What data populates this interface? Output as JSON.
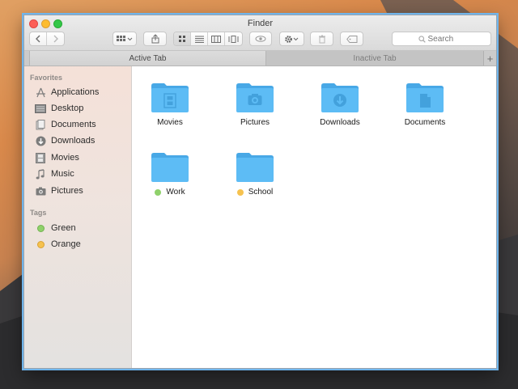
{
  "window": {
    "title": "Finder"
  },
  "toolbar": {
    "search_placeholder": "Search",
    "icons": [
      "back-arrow-icon",
      "forward-arrow-icon",
      "arrange-icon",
      "share-icon",
      "icon-view-icon",
      "list-view-icon",
      "column-view-icon",
      "coverflow-view-icon",
      "quicklook-eye-icon",
      "action-gear-icon",
      "trash-icon",
      "tag-icon"
    ]
  },
  "tabs": [
    {
      "label": "Active Tab",
      "active": true
    },
    {
      "label": "Inactive Tab",
      "active": false
    }
  ],
  "tab_add_label": "+",
  "sidebar": {
    "favorites_heading": "Favorites",
    "favorites": [
      {
        "label": "Applications",
        "icon": "applications-icon"
      },
      {
        "label": "Desktop",
        "icon": "desktop-icon"
      },
      {
        "label": "Documents",
        "icon": "documents-icon"
      },
      {
        "label": "Downloads",
        "icon": "downloads-icon"
      },
      {
        "label": "Movies",
        "icon": "movies-icon"
      },
      {
        "label": "Music",
        "icon": "music-icon"
      },
      {
        "label": "Pictures",
        "icon": "pictures-icon"
      }
    ],
    "tags_heading": "Tags",
    "tags": [
      {
        "label": "Green",
        "color": "#8fd16b"
      },
      {
        "label": "Orange",
        "color": "#f6c24f"
      }
    ]
  },
  "files": [
    {
      "label": "Movies",
      "glyph": "film-icon",
      "tag_color": null
    },
    {
      "label": "Pictures",
      "glyph": "camera-icon",
      "tag_color": null
    },
    {
      "label": "Downloads",
      "glyph": "download-arrow-icon",
      "tag_color": null
    },
    {
      "label": "Documents",
      "glyph": "document-icon",
      "tag_color": null
    },
    {
      "label": "Work",
      "glyph": null,
      "tag_color": "#8fd16b"
    },
    {
      "label": "School",
      "glyph": null,
      "tag_color": "#f6c24f"
    }
  ],
  "colors": {
    "folder": "#5dbcf5",
    "folder_dark": "#48a8e6",
    "selection_border": "#6fb5ec"
  }
}
